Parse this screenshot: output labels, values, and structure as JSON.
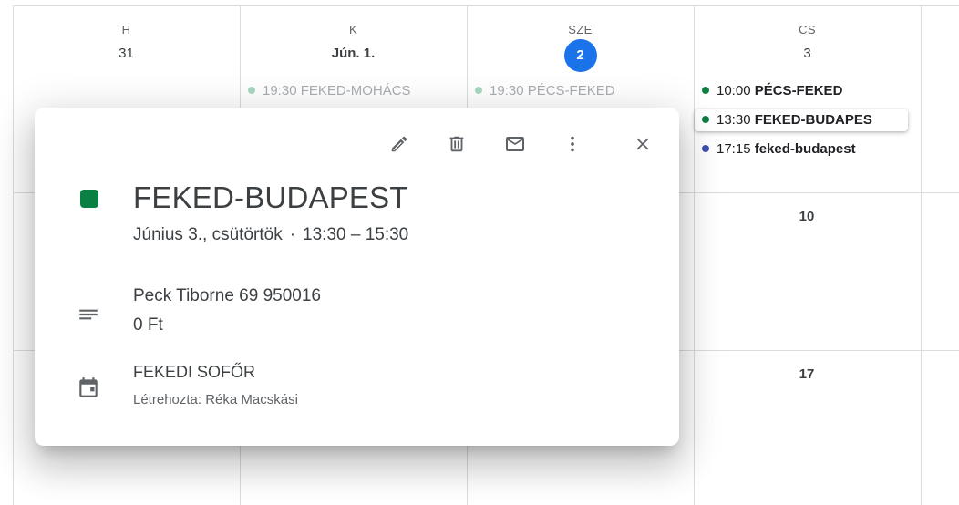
{
  "week": {
    "days": [
      {
        "dow": "H",
        "num": "31"
      },
      {
        "dow": "K",
        "num": "Jún. 1."
      },
      {
        "dow": "SZE",
        "num": "2"
      },
      {
        "dow": "CS",
        "num": "3"
      }
    ],
    "events": {
      "tue": {
        "time": "19:30",
        "title": "FEKED-MOHÁCS"
      },
      "wed": {
        "time": "19:30",
        "title": "PÉCS-FEKED"
      },
      "thu": [
        {
          "time": "10:00",
          "title": "PÉCS-FEKED"
        },
        {
          "time": "13:30",
          "title": "FEKED-BUDAPES"
        },
        {
          "time": "17:15",
          "title": "feked-budapest"
        }
      ]
    },
    "row2_num": "10",
    "row3_num": "17"
  },
  "popup": {
    "title": "FEKED-BUDAPEST",
    "date": "Június 3., csütörtök",
    "separator": "·",
    "time": "13:30 – 15:30",
    "description_line1": "Peck Tiborne 69 950016",
    "description_line2": "0 Ft",
    "calendar_name": "FEKEDI SOFŐR",
    "created_by": "Létrehozta: Réka Macskási",
    "event_color": "#0b8043"
  },
  "colors": {
    "today": "#1a73e8",
    "green_event": "#0b8043",
    "blue_event": "#3f51b5",
    "faded_dot": "#a8d8bf"
  },
  "icons": [
    "edit-icon",
    "delete-icon",
    "email-icon",
    "more-options-icon",
    "close-icon",
    "description-icon",
    "calendar-icon"
  ]
}
